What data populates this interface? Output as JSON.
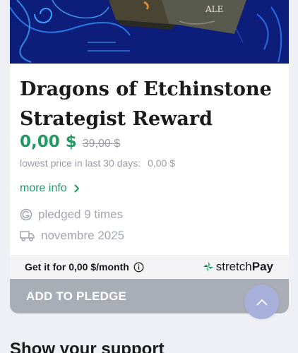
{
  "product": {
    "title_line1": "Dragons of Etchinstone",
    "title_line2": "Strategist Reward",
    "price": "0,00 $",
    "old_price": "39,00 $",
    "lowest_label": "lowest price in last 30 days:",
    "lowest_value": "0,00 $",
    "more_info": "more info",
    "pledged": "pledged 9 times",
    "delivery_date": "novembre 2025",
    "art_text": "ALE"
  },
  "stretchpay": {
    "get_it": "Get it for 0,00 $/month",
    "brand_light": "stretch",
    "brand_bold": "Pay"
  },
  "actions": {
    "add_to_pledge": "ADD TO PLEDGE"
  },
  "section": {
    "title": "Show your support"
  },
  "colors": {
    "price_green": "#1f9a63",
    "button_gray": "#a9adb6",
    "scroll_button": "#a6b0d8"
  }
}
